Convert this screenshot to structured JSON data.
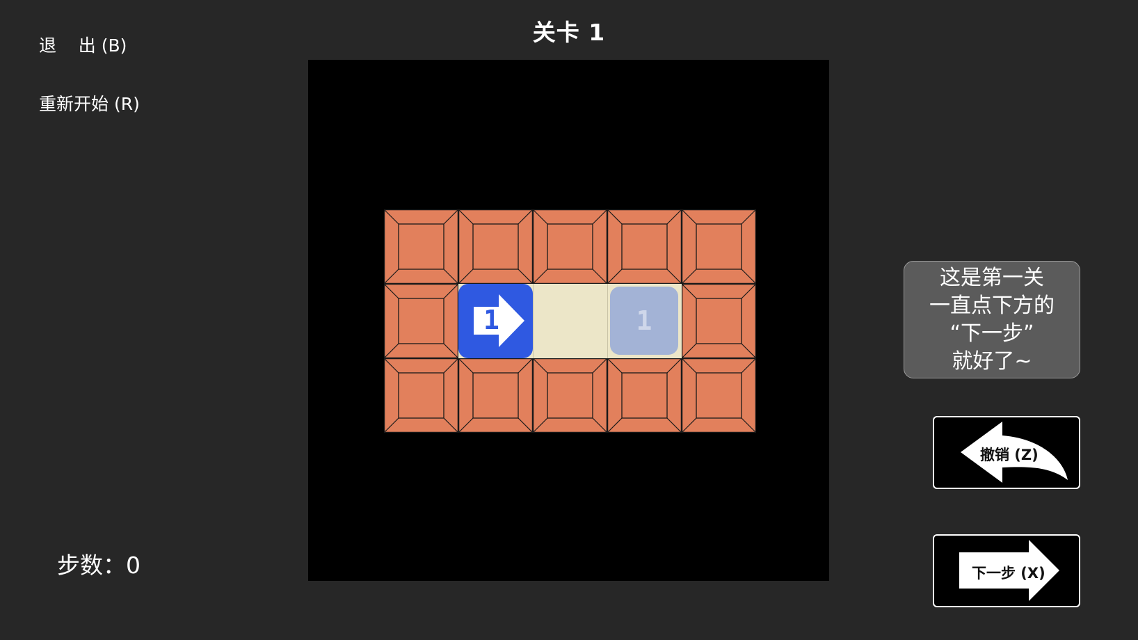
{
  "menu": {
    "exit_label": "退    出 (B)",
    "restart_label": "重新开始 (R)"
  },
  "level": {
    "title": "关卡 1"
  },
  "stats": {
    "steps_label": "步数：0"
  },
  "board": {
    "rows": 3,
    "cols": 5,
    "player": {
      "number": "1",
      "direction": "right",
      "row": 1,
      "col": 1
    },
    "target": {
      "number": "1",
      "row": 1,
      "col": 3
    },
    "colors": {
      "wall": "#e2805c",
      "floor": "#ece6c8",
      "player": "#2f59e1",
      "target": "#a3b3d6",
      "board": "#000000"
    }
  },
  "hint": {
    "lines": [
      "这是第一关",
      "一直点下方的",
      "“下一步”",
      "就好了~"
    ]
  },
  "buttons": {
    "undo_label": "撤销 (Z)",
    "next_label": "下一步 (X)"
  }
}
